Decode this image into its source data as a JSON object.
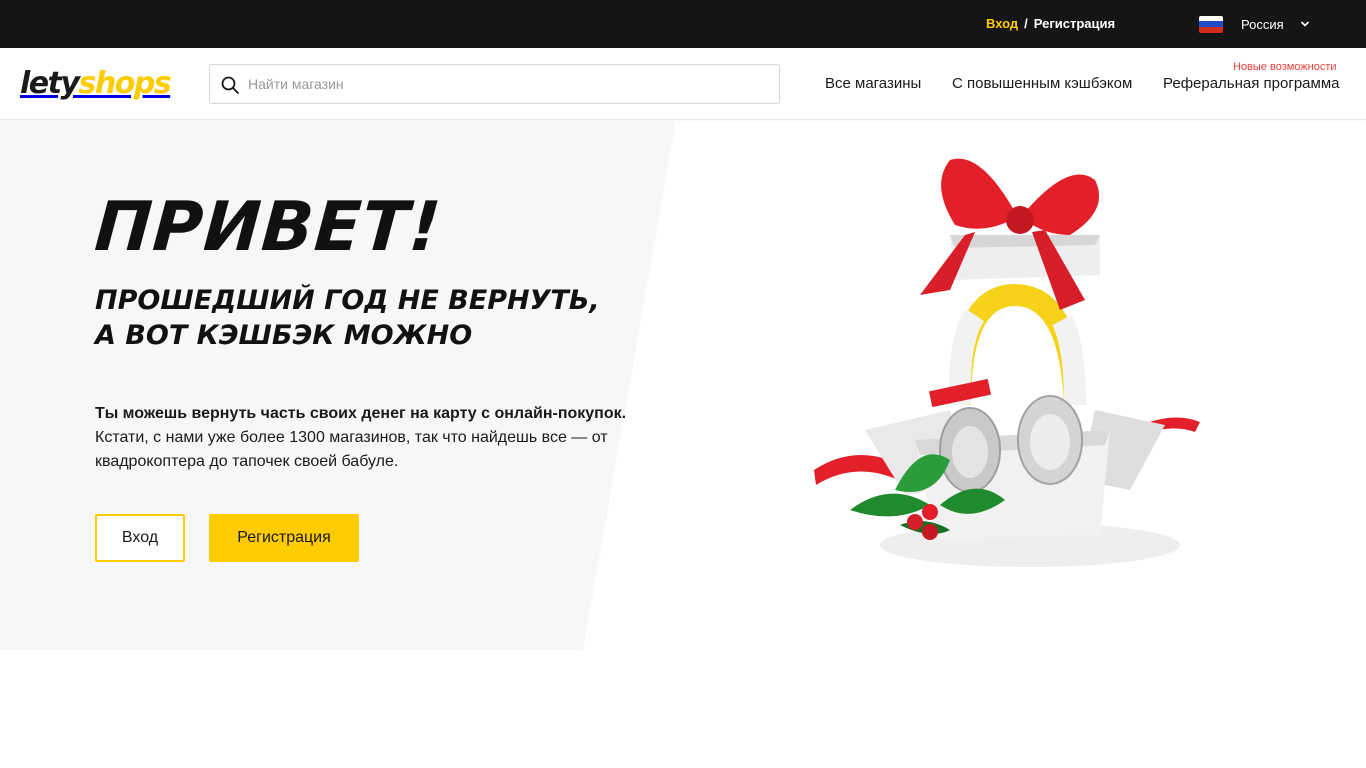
{
  "topbar": {
    "login_label": "Вход",
    "separator": "/",
    "register_label": "Регистрация",
    "country": "Россия",
    "flag_icon": "russia-flag-icon",
    "colors": {
      "background": "#151515",
      "login": "#ffcc00"
    }
  },
  "header": {
    "logo": {
      "part1": "lety",
      "part2": "shops"
    },
    "search": {
      "placeholder": "Найти магазин",
      "value": "",
      "icon": "search-icon"
    },
    "nav": {
      "all_shops": "Все магазины",
      "boosted_cashback": "С повышенным кэшбэком",
      "referral": "Реферальная программа",
      "new_features_badge": "Новые возможности"
    }
  },
  "hero": {
    "title": "ПРИВЕТ!",
    "subtitle_line1": "ПРОШЕДШИЙ ГОД НЕ ВЕРНУТЬ,",
    "subtitle_line2": "А ВОТ КЭШБЭК МОЖНО",
    "text_bold": "Ты можешь вернуть часть своих денег на карту с онлайн-покупок.",
    "text": "Кстати, с нами уже более 1300 магазинов, так что найдешь все — от квадрокоптера до тапочек своей бабуле.",
    "login_button": "Вход",
    "register_button": "Регистрация",
    "image_icon": "gift-box-headphones-illustration"
  },
  "colors": {
    "accent": "#ffcc00",
    "text": "#1a1a1a",
    "badge": "#e6423c",
    "hero_background": "#f7f7f7"
  }
}
